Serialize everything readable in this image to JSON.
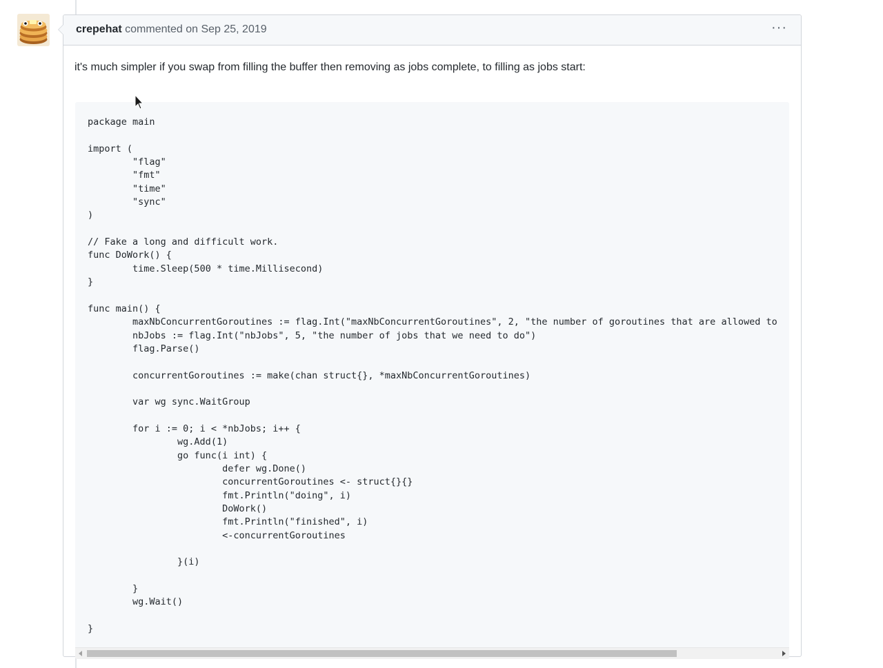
{
  "comment": {
    "author": "crepehat",
    "action": "commented on",
    "date": "Sep 25, 2019",
    "menu_label": "···",
    "intro": "it's much simpler if you swap from filling the buffer then removing as jobs complete, to filling as jobs start:",
    "code": "package main\n\nimport (\n\t\"flag\"\n\t\"fmt\"\n\t\"time\"\n\t\"sync\"\n)\n\n// Fake a long and difficult work.\nfunc DoWork() {\n\ttime.Sleep(500 * time.Millisecond)\n}\n\nfunc main() {\n\tmaxNbConcurrentGoroutines := flag.Int(\"maxNbConcurrentGoroutines\", 2, \"the number of goroutines that are allowed to\n\tnbJobs := flag.Int(\"nbJobs\", 5, \"the number of jobs that we need to do\")\n\tflag.Parse()\n\n\tconcurrentGoroutines := make(chan struct{}, *maxNbConcurrentGoroutines)\n\n\tvar wg sync.WaitGroup\n\n\tfor i := 0; i < *nbJobs; i++ {\n\t\twg.Add(1)\n\t\tgo func(i int) {\n\t\t\tdefer wg.Done()\n\t\t\tconcurrentGoroutines <- struct{}{}\n\t\t\tfmt.Println(\"doing\", i)\n\t\t\tDoWork()\n\t\t\tfmt.Println(\"finished\", i)\n\t\t\t<-concurrentGoroutines\n\n\t\t}(i)\n\n\t}\n\twg.Wait()\n\n}",
    "scroll_position": 0
  },
  "colors": {
    "header_bg": "#f6f8fa",
    "border": "#d1d5da",
    "code_bg": "#f6f8fa"
  }
}
